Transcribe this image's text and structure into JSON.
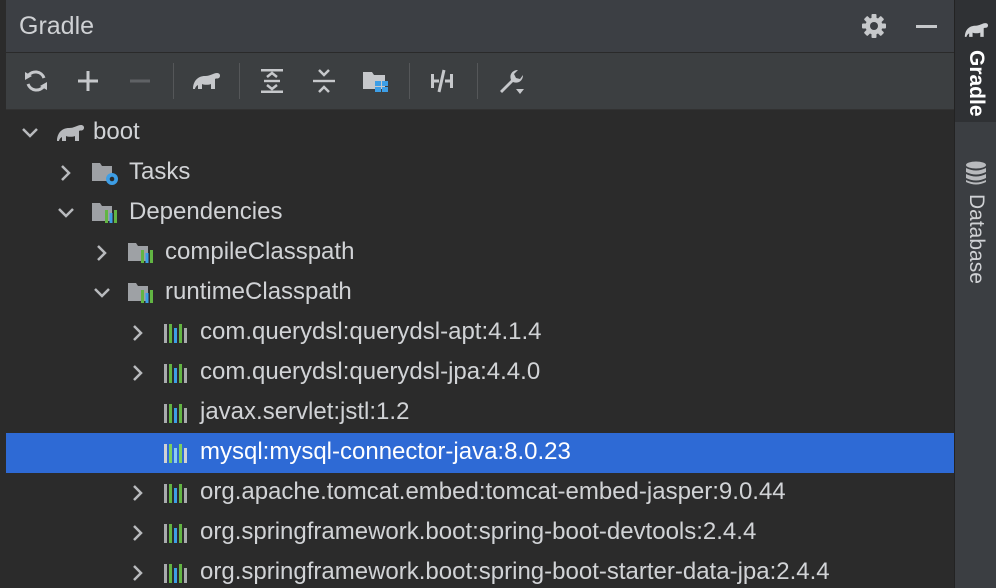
{
  "header": {
    "title": "Gradle",
    "settings_icon": "gear-icon",
    "minimize_icon": "minimize-icon"
  },
  "toolbar": {
    "buttons": [
      {
        "name": "reload-all-gradle-projects",
        "icon": "refresh-icon"
      },
      {
        "name": "add-gradle-project",
        "icon": "plus-icon"
      },
      {
        "name": "remove-gradle-project",
        "icon": "minus-icon"
      },
      {
        "name": "execute-gradle-task",
        "icon": "elephant-icon"
      },
      {
        "name": "expand-all",
        "icon": "expand-all-icon"
      },
      {
        "name": "collapse-all",
        "icon": "collapse-all-icon"
      },
      {
        "name": "group-modules",
        "icon": "folder-modules-icon"
      },
      {
        "name": "toggle-offline-mode",
        "icon": "offline-icon"
      },
      {
        "name": "build-tool-settings",
        "icon": "wrench-icon"
      }
    ]
  },
  "tree": {
    "rows": [
      {
        "label": "boot",
        "level": 0,
        "expanded": true,
        "icon": "gradle-elephant-icon",
        "selected": false
      },
      {
        "label": "Tasks",
        "level": 1,
        "expanded": false,
        "icon": "tasks-folder-icon",
        "selected": false
      },
      {
        "label": "Dependencies",
        "level": 1,
        "expanded": true,
        "icon": "dependencies-folder-icon",
        "selected": false
      },
      {
        "label": "compileClasspath",
        "level": 2,
        "expanded": false,
        "icon": "dependencies-folder-icon",
        "selected": false
      },
      {
        "label": "runtimeClasspath",
        "level": 2,
        "expanded": true,
        "icon": "dependencies-folder-icon",
        "selected": false
      },
      {
        "label": "com.querydsl:querydsl-apt:4.1.4",
        "level": 3,
        "expanded": false,
        "icon": "library-icon",
        "selected": false
      },
      {
        "label": "com.querydsl:querydsl-jpa:4.4.0",
        "level": 3,
        "expanded": false,
        "icon": "library-icon",
        "selected": false
      },
      {
        "label": "javax.servlet:jstl:1.2",
        "level": 3,
        "leaf": true,
        "icon": "library-icon",
        "selected": false
      },
      {
        "label": "mysql:mysql-connector-java:8.0.23",
        "level": 3,
        "leaf": true,
        "icon": "library-icon",
        "selected": true
      },
      {
        "label": "org.apache.tomcat.embed:tomcat-embed-jasper:9.0.44",
        "level": 3,
        "expanded": false,
        "icon": "library-icon",
        "selected": false
      },
      {
        "label": "org.springframework.boot:spring-boot-devtools:2.4.4",
        "level": 3,
        "expanded": false,
        "icon": "library-icon",
        "selected": false
      },
      {
        "label": "org.springframework.boot:spring-boot-starter-data-jpa:2.4.4",
        "level": 3,
        "expanded": false,
        "icon": "library-icon",
        "selected": false
      }
    ]
  },
  "right_strip": {
    "tabs": [
      {
        "label": "Gradle",
        "icon": "gradle-elephant-icon",
        "active": true
      },
      {
        "label": "Database",
        "icon": "database-icon",
        "active": false
      }
    ]
  },
  "colors": {
    "selection": "#2e6ad5",
    "folder_blue": "#3d9ee6",
    "library_green": "#62b543"
  }
}
